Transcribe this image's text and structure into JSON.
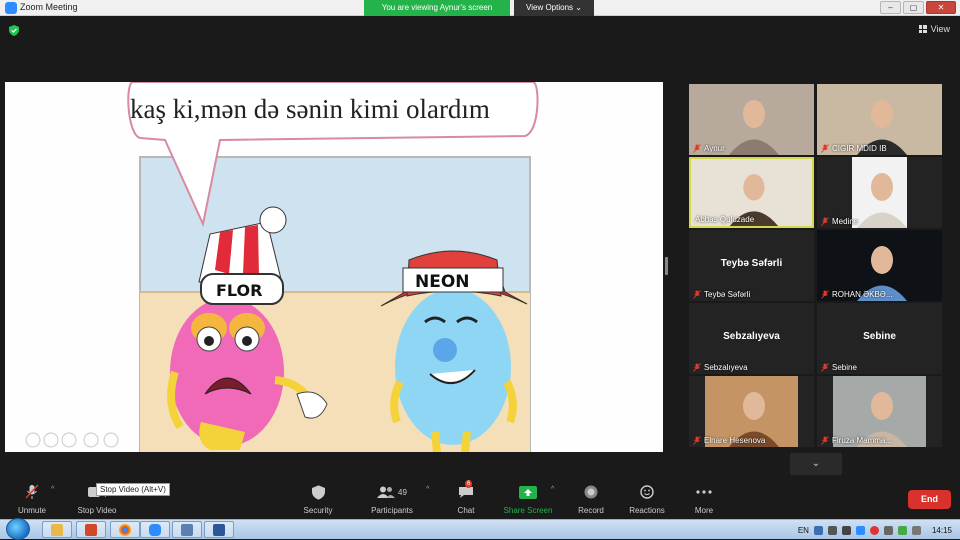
{
  "window": {
    "title": "Zoom Meeting",
    "viewing_banner": "You are viewing Aynur's screen",
    "view_options": "View Options ⌄",
    "view_button": "View"
  },
  "shared_screen": {
    "speech_text": "kaş ki,mən də sənin kimi olardım",
    "hat_left": "FLOR",
    "hat_right": "NEON"
  },
  "participants": [
    {
      "name": "Aynur",
      "video": true,
      "muted": true,
      "active": false
    },
    {
      "name": "CIGIR MDID IB",
      "video": true,
      "muted": true,
      "active": false
    },
    {
      "name": "Abbas Quluzade",
      "video": true,
      "muted": false,
      "active": true
    },
    {
      "name": "Medine",
      "video": true,
      "muted": true,
      "active": false
    },
    {
      "name": "Teybə Səfərli",
      "video": false,
      "muted": true,
      "active": false
    },
    {
      "name": "ROHAN ƏKBƏ...",
      "video": true,
      "muted": true,
      "active": false
    },
    {
      "name": "Sebzalıyeva",
      "video": false,
      "muted": true,
      "active": false
    },
    {
      "name": "Sebine",
      "video": false,
      "muted": true,
      "active": false
    },
    {
      "name": "Elnare Hesenova",
      "video": true,
      "muted": true,
      "active": false
    },
    {
      "name": "Firuza Mamma...",
      "video": true,
      "muted": true,
      "active": false
    }
  ],
  "toolbar": {
    "unmute": "Unmute",
    "stop_video": "Stop Video",
    "stop_video_tooltip": "Stop Video (Alt+V)",
    "security": "Security",
    "participants": "Participants",
    "participants_count": "49",
    "chat": "Chat",
    "chat_badge": "6",
    "share_screen": "Share Screen",
    "record": "Record",
    "reactions": "Reactions",
    "more": "More",
    "end": "End"
  },
  "taskbar": {
    "language": "EN",
    "time": "14:15"
  },
  "colors": {
    "accent_green": "#24b34b",
    "end_red": "#d9312b",
    "active_border": "#d4d94a"
  }
}
